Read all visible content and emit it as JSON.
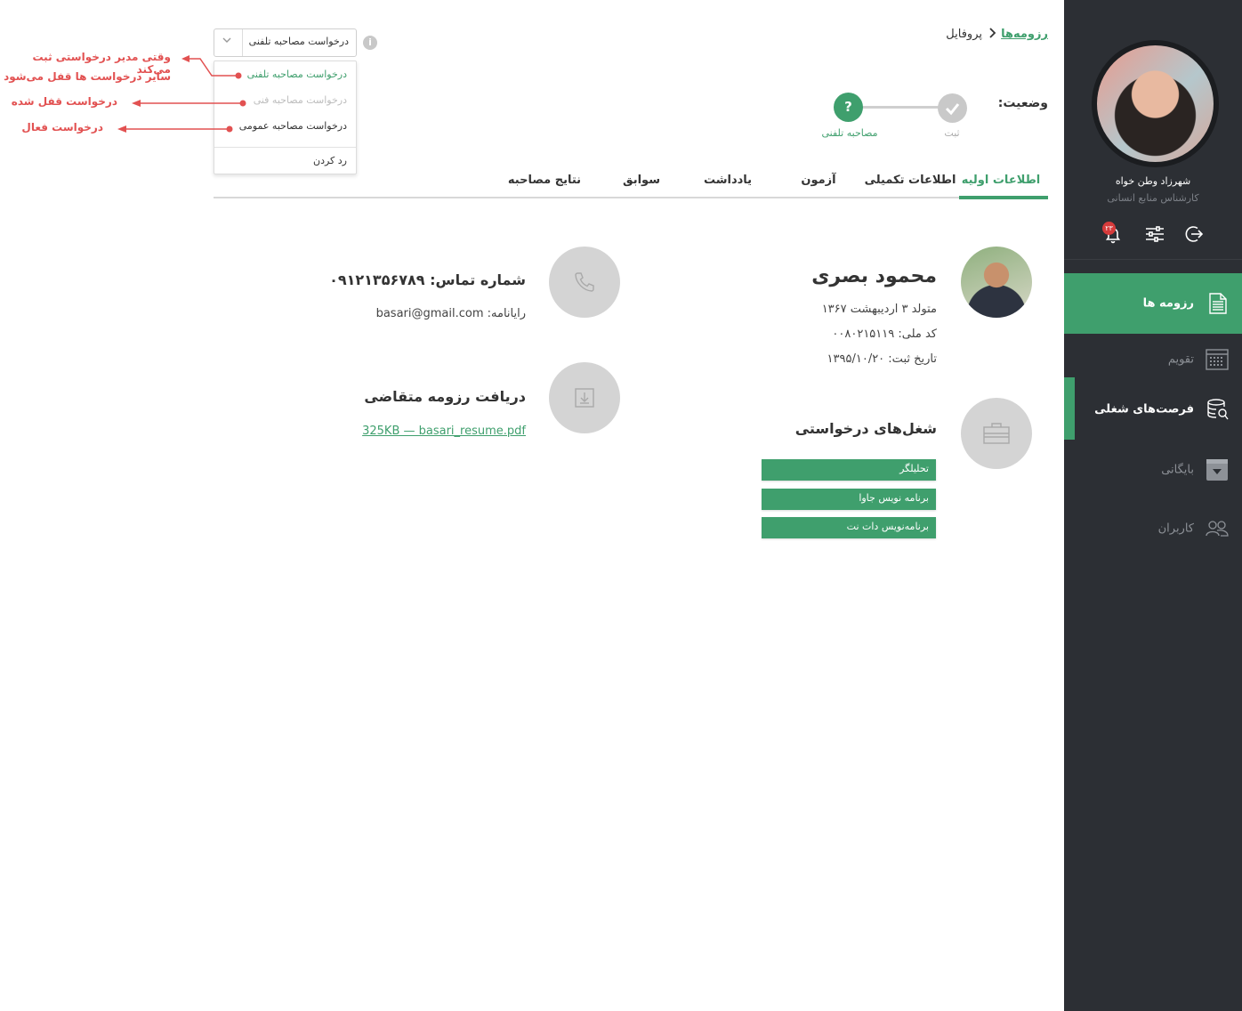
{
  "sidebar": {
    "user_name": "شهرزاد  وطن خواه",
    "user_role": "کارشناس منابع انسانی",
    "notification_count": "۲۳",
    "nav": [
      {
        "label": "رزومه ها",
        "icon": "document-icon",
        "active": true
      },
      {
        "label": "تقویم",
        "icon": "calendar-icon"
      },
      {
        "label": "فرصت‌های شغلی",
        "icon": "job-search-icon"
      },
      {
        "label": "بایگانی",
        "icon": "archive-icon"
      },
      {
        "label": "کاربران",
        "icon": "users-icon"
      }
    ]
  },
  "breadcrumb": {
    "parent": "رزومه‌ها",
    "current": "پروفایل"
  },
  "status": {
    "label": "وضعیت:",
    "steps": [
      {
        "label": "ثبت",
        "state": "done"
      },
      {
        "label": "مصاحبه تلفنی",
        "state": "current"
      }
    ]
  },
  "dropdown": {
    "value": "درخواست مصاحبه تلفنی",
    "options": [
      {
        "label": "درخواست مصاحبه تلفنی",
        "state": "selected"
      },
      {
        "label": "درخواست مصاحبه فنی",
        "state": "locked"
      },
      {
        "label": "درخواست مصاحبه عمومی",
        "state": "active"
      },
      {
        "label": "رد کردن",
        "state": "active"
      }
    ]
  },
  "annotations": {
    "note1_line1": "وقتی مدیر درخواستی  ثبت می‌کند",
    "note1_line2": "سایر درخواست ها قفل می‌شود",
    "note2": "درخواست قفل شده",
    "note3": "درخواست فعال"
  },
  "tabs": [
    {
      "label": "اطلاعات اولیه",
      "active": true
    },
    {
      "label": "اطلاعات تکمیلی"
    },
    {
      "label": "آزمون"
    },
    {
      "label": "یادداشت"
    },
    {
      "label": "سوابق"
    },
    {
      "label": "نتایج مصاحبه"
    }
  ],
  "candidate": {
    "name": "محمود بصری",
    "birth": "متولد ۳ اردیبهشت ۱۳۶۷",
    "national_id": "کد ملی: ۰۰۸۰۲۱۵۱۱۹",
    "registered": "تاریخ ثبت: ۱۳۹۵/۱۰/۲۰",
    "phone": "شماره تماس: ۰۹۱۲۱۳۵۶۷۸۹",
    "email": "رایانامه: basari@gmail.com",
    "resume_title": "دریافت رزومه متقاضی",
    "resume_file": "325KB — basari_resume.pdf",
    "jobs_title": "شغل‌های درخواستی",
    "jobs": [
      "تحلیلگر",
      "برنامه نویس جاوا",
      "برنامه‌نویس دات نت"
    ]
  },
  "colors": {
    "accent": "#3f9f6d",
    "sidebar": "#2c2f34",
    "annotation": "#e25151"
  }
}
